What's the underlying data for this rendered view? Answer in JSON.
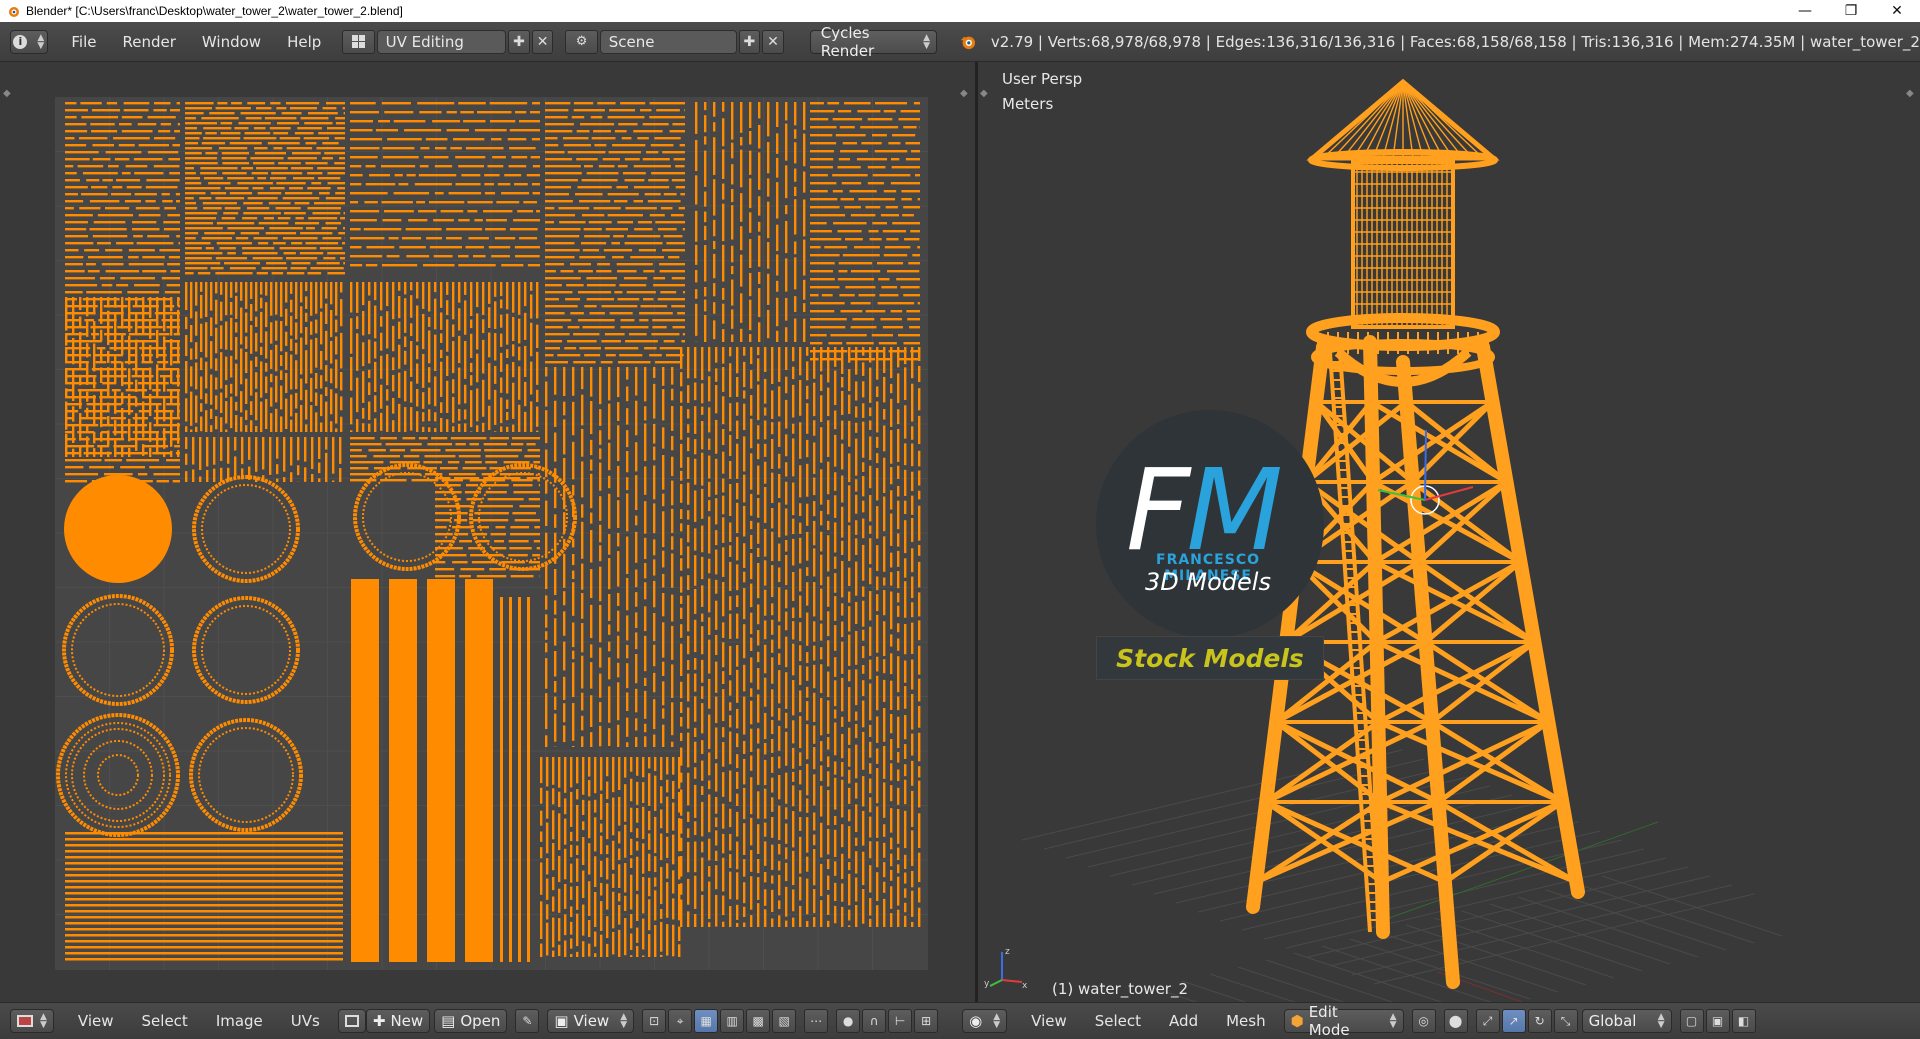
{
  "window": {
    "title": "Blender* [C:\\Users\\franc\\Desktop\\water_tower_2\\water_tower_2.blend]",
    "controls": {
      "minimize": "—",
      "maximize": "❐",
      "close": "✕"
    }
  },
  "info_header": {
    "menus": [
      "File",
      "Render",
      "Window",
      "Help"
    ],
    "layout_name": "UV Editing",
    "scene_name": "Scene",
    "render_engine": "Cycles Render",
    "stats": "v2.79 | Verts:68,978/68,978 | Edges:136,316/136,316 | Faces:68,158/68,158 | Tris:136,316 | Mem:274.35M | water_tower_2"
  },
  "viewport": {
    "view_name": "User Persp",
    "units": "Meters",
    "object_label": "(1) water_tower_2"
  },
  "logo": {
    "letter_f": "F",
    "letter_m": "M",
    "name": "FRANCESCO MILANESE",
    "subtitle": "3D Models",
    "badge": "Stock Models"
  },
  "uv_footer": {
    "menus": [
      "View",
      "Select",
      "Image",
      "UVs"
    ],
    "new_label": "New",
    "open_label": "Open",
    "view_label": "View"
  },
  "view3d_footer": {
    "menus": [
      "View",
      "Select",
      "Add",
      "Mesh"
    ],
    "mode": "Edit Mode",
    "orientation": "Global"
  },
  "colors": {
    "uv_orange": "#ff8c00",
    "wire_orange": "#ffa01e",
    "logo_blue": "#2aa3dc",
    "logo_yellow": "#c9c41b"
  }
}
